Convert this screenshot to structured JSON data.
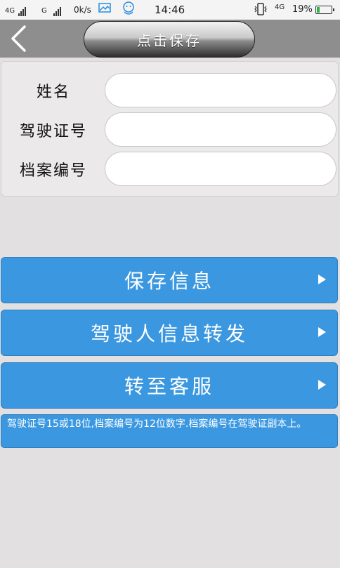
{
  "status_bar": {
    "network1": "4G",
    "network2": "G",
    "speed": "0k/s",
    "time": "14:46",
    "network3": "4G",
    "battery": "19%",
    "battery_level": 0.19
  },
  "header": {
    "back_icon": "chevron-left-icon",
    "save_button_label": "点击保存"
  },
  "form": {
    "fields": [
      {
        "label": "姓名",
        "value": ""
      },
      {
        "label": "驾驶证号",
        "value": ""
      },
      {
        "label": "档案编号",
        "value": ""
      }
    ]
  },
  "actions": [
    {
      "label": "保存信息"
    },
    {
      "label": "驾驶人信息转发"
    },
    {
      "label": "转至客服"
    }
  ],
  "note": "驾驶证号15或18位,档案编号为12位数字.档案编号在驾驶证副本上。"
}
